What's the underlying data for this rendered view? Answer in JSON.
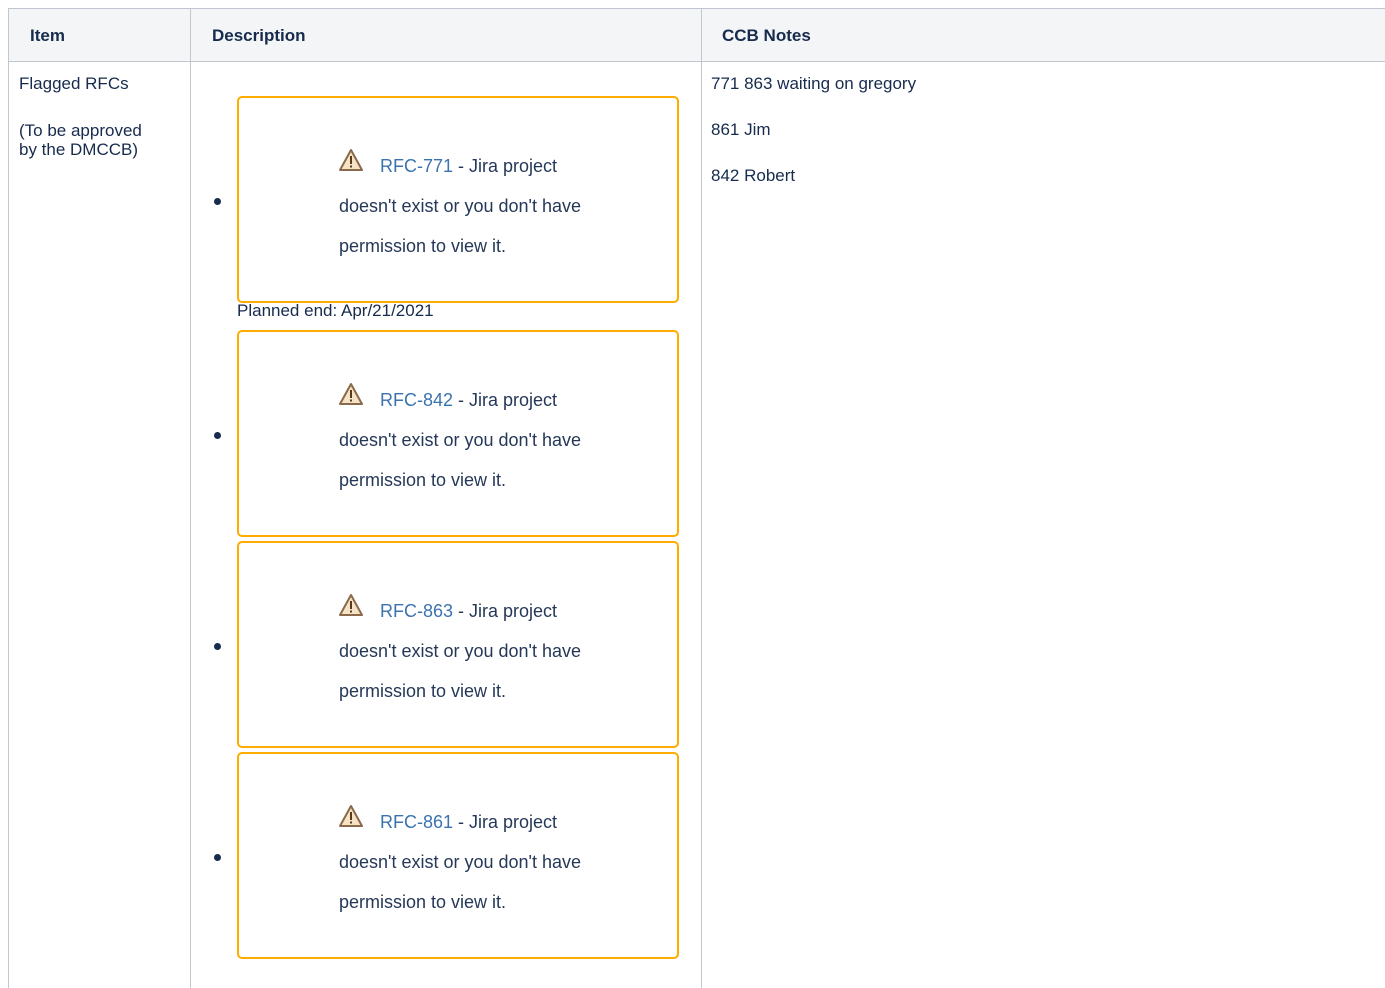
{
  "table": {
    "headers": [
      "Item",
      "Description",
      "CCB Notes"
    ],
    "item": {
      "title": "Flagged RFCs",
      "subtitle_line1": "(To be approved",
      "subtitle_line2": "by the DMCCB)"
    },
    "planned_end": "Planned end: Apr/21/2021",
    "jira_issues": [
      {
        "key": "RFC-771",
        "after_key": " - Jira project",
        "line2": "doesn't exist or you don't have",
        "line3": "permission to view it."
      },
      {
        "key": "RFC-842",
        "after_key": " - Jira project",
        "line2": "doesn't exist or you don't have",
        "line3": "permission to view it."
      },
      {
        "key": "RFC-863",
        "after_key": " - Jira project",
        "line2": "doesn't exist or you don't have",
        "line3": "permission to view it."
      },
      {
        "key": "RFC-861",
        "after_key": " - Jira project",
        "line2": "doesn't exist or you don't have",
        "line3": "permission to view it."
      }
    ],
    "ccb_notes": [
      "771 863 waiting on gregory",
      "861 Jim",
      "842 Robert"
    ]
  },
  "colors": {
    "warning_border": "#ffab00",
    "link": "#3b73af",
    "text": "#172b4d",
    "header_bg": "#f4f5f7",
    "grid": "#c1c7d0"
  },
  "icons": {
    "warning": "warning-triangle-icon",
    "bullet": "bullet-icon"
  }
}
